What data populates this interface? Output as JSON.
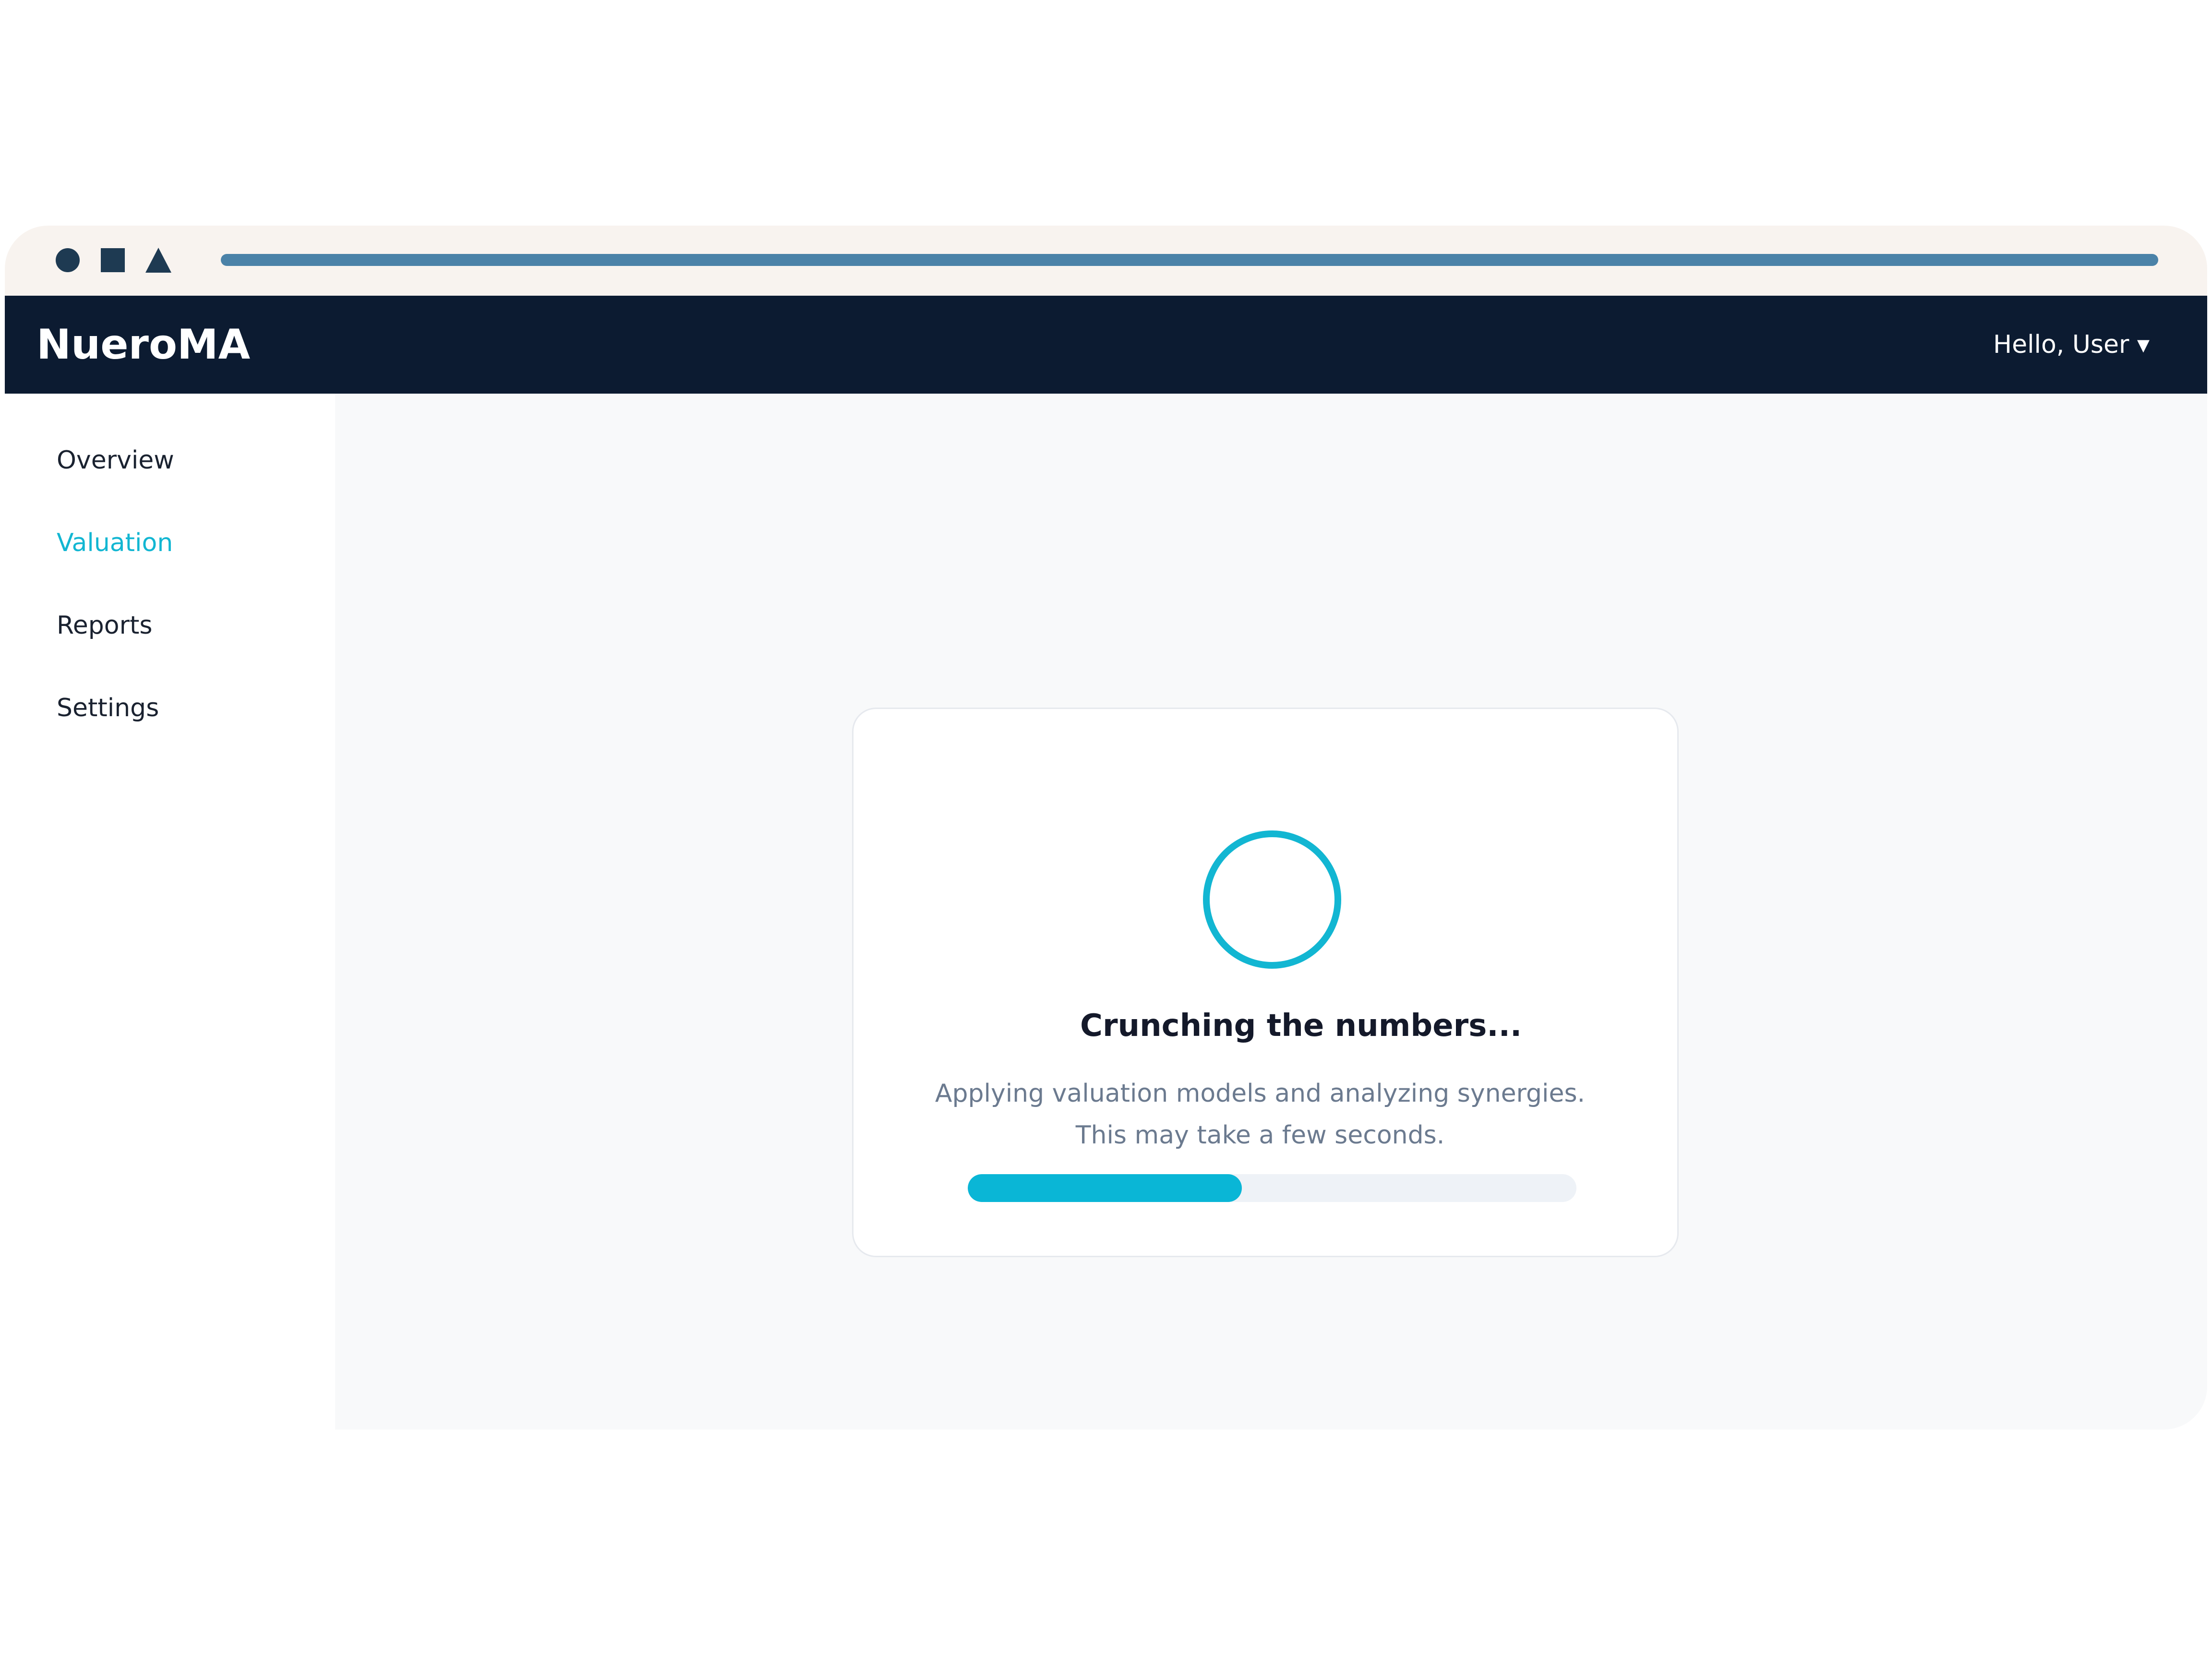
{
  "app": {
    "brand": "NueroMA",
    "user_menu_label": "Hello, User ▾"
  },
  "window_controls": {
    "icons": [
      "circle-icon",
      "square-icon",
      "triangle-icon"
    ]
  },
  "sidebar": {
    "items": [
      {
        "label": "Overview",
        "active": false
      },
      {
        "label": "Valuation",
        "active": true
      },
      {
        "label": "Reports",
        "active": false
      },
      {
        "label": "Settings",
        "active": false
      }
    ]
  },
  "loading": {
    "title": "Crunching the numbers...",
    "message_line1": "Applying valuation models and analyzing synergies.",
    "message_line2": "This may take a few seconds.",
    "progress_fraction": 0.45
  },
  "colors": {
    "accent": "#12b6d2",
    "topbar": "#0c1b31",
    "active_nav": "#12b6d2"
  }
}
